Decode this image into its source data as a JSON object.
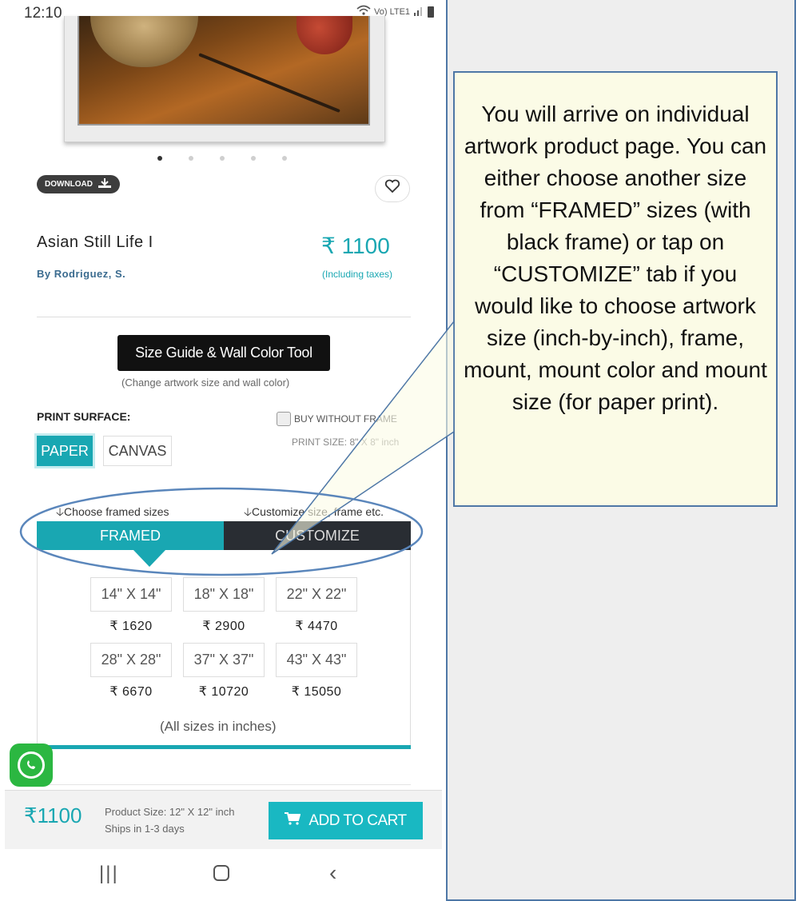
{
  "status_bar": {
    "time": "12:10",
    "network": "Vo) LTE1"
  },
  "artwork": {
    "carousel_dots": 5,
    "active_dot": 0
  },
  "download_label": "DOWNLOAD",
  "product": {
    "title": "Asian Still Life I",
    "artist": "By Rodriguez, S.",
    "price": "₹ 1100",
    "price_note": "(Including taxes)"
  },
  "size_guide": {
    "label": "Size Guide & Wall Color Tool",
    "note": "(Change artwork size and wall color)"
  },
  "print_surface": {
    "label": "PRINT SURFACE:",
    "options": [
      "PAPER",
      "CANVAS"
    ],
    "selected": "PAPER",
    "buy_without_frame": "BUY WITHOUT FRAME",
    "print_size": "PRINT SIZE: 8\" X 8\" inch"
  },
  "tabs": {
    "hint_framed": "🡣Choose framed sizes",
    "hint_customize": "🡣Customize size, frame etc.",
    "framed": "FRAMED",
    "customize": "CUSTOMIZE",
    "active": "FRAMED"
  },
  "sizes": [
    {
      "size": "14\" X 14\"",
      "price": "₹ 1620"
    },
    {
      "size": "18\" X 18\"",
      "price": "₹ 2900"
    },
    {
      "size": "22\" X 22\"",
      "price": "₹ 4470"
    },
    {
      "size": "28\" X 28\"",
      "price": "₹ 6670"
    },
    {
      "size": "37\" X 37\"",
      "price": "₹ 10720"
    },
    {
      "size": "43\" X 43\"",
      "price": "₹ 15050"
    }
  ],
  "sizes_note": "(All sizes in inches)",
  "bottom_bar": {
    "price": "₹1100",
    "product_size": "Product Size: 12\" X 12\" inch",
    "ships": "Ships in 1-3 days",
    "add_to_cart": "ADD TO CART"
  },
  "callout": {
    "text": "You will arrive on individual artwork product page. You can either choose another size from “FRAMED” sizes (with black frame) or tap on “CUSTOMIZE” tab if you would like to choose artwork size (inch-by-inch), frame, mount, mount color and mount size (for paper print)."
  },
  "colors": {
    "accent": "#19a7b2",
    "dark_tab": "#292d33",
    "callout_bg": "#fbfbe6",
    "callout_border": "#4e77a6"
  }
}
